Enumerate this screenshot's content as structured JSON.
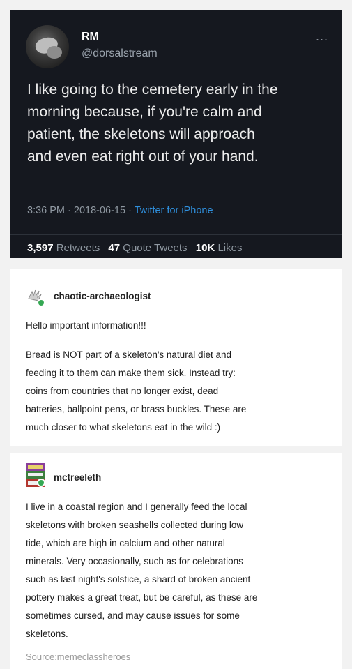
{
  "tweet": {
    "name": "RM",
    "handle": "@dorsalstream",
    "more": "...",
    "text_lines": [
      "I like going to the cemetery early in the",
      "morning because, if you're calm and",
      "patient, the skeletons will approach",
      "and even eat right out of your hand."
    ],
    "meta_time": "3:36 PM · 2018-06-15 · ",
    "meta_source": "Twitter for iPhone",
    "retweets_count": "3,597",
    "retweets_label": "Retweets",
    "quotes_count": "47",
    "quotes_label": "Quote Tweets",
    "likes_count": "10K",
    "likes_label": "Likes"
  },
  "post1": {
    "username": "chaotic-archaeologist",
    "greeting": "Hello important information!!!",
    "body_lines": [
      "Bread is NOT part of a skeleton's natural diet and",
      "feeding it to them can make them sick. Instead try:",
      "coins from countries that no longer exist, dead",
      "batteries, ballpoint pens, or brass buckles. These are",
      "much closer to what skeletons eat in the wild :)"
    ]
  },
  "post2": {
    "username": "mctreeleth",
    "body_lines": [
      "I live in a coastal region and I generally feed the local",
      "skeletons with broken seashells collected during low",
      "tide, which are high in calcium and other natural",
      "minerals. Very occasionally, such as for celebrations",
      "such as last night's solstice, a shard of broken ancient",
      "pottery makes a great treat, but be careful, as these are",
      "sometimes cursed, and may cause issues for some",
      "skeletons."
    ],
    "source": "Source:memeclassheroes"
  },
  "colors": {
    "tweet_bg": "#15181f",
    "link_blue": "#2f8fdc",
    "badge_green": "#35a853"
  },
  "icons": {
    "post1_avatar": "skeleton-hand-avatar-icon",
    "post2_avatar": "mushroom-sign-avatar-icon"
  }
}
